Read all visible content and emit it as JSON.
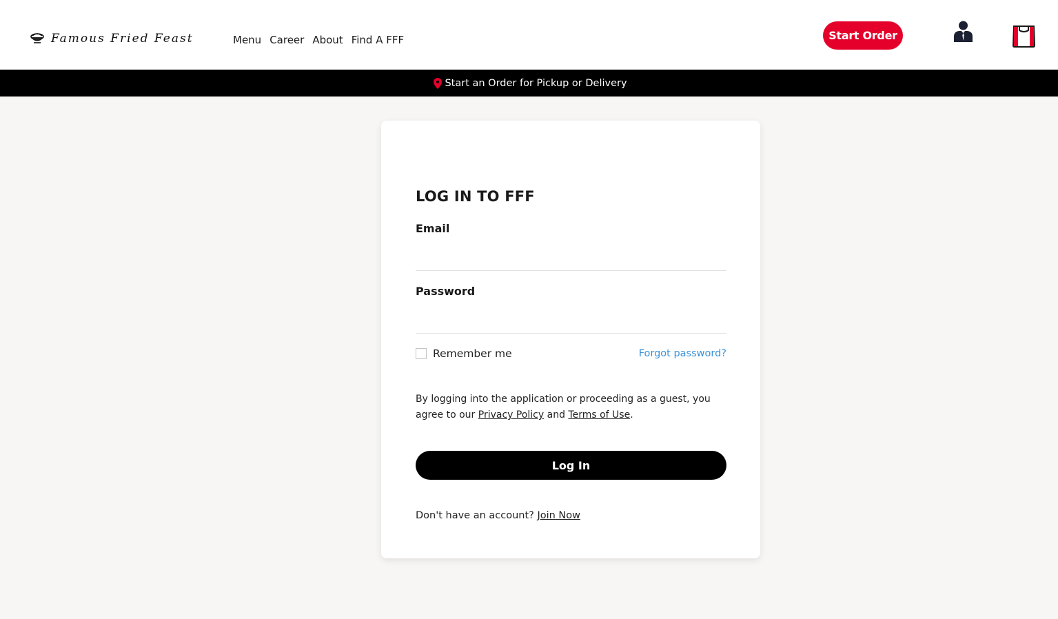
{
  "header": {
    "logo_text": "Famous Fried Feast",
    "logo_icon": "fried-chicken-bowl-icon",
    "nav": [
      "Menu",
      "Career",
      "About",
      "Find A FFF"
    ],
    "start_order_label": "Start Order",
    "account_icon": "user-account-icon",
    "cart_icon": "shopping-bag-icon",
    "brand_color": "#e4002b"
  },
  "promo": {
    "text": "Start an Order for Pickup or Delivery",
    "icon": "location-pin-icon"
  },
  "login": {
    "title": "LOG IN TO FFF",
    "email_label": "Email",
    "email_value": "",
    "password_label": "Password",
    "password_value": "",
    "remember_label": "Remember me",
    "forgot_label": "Forgot password?",
    "consent_prefix": "By logging into the application or proceeding as a guest, you agree to our",
    "privacy_label": "Privacy Policy",
    "consent_and": "and",
    "terms_label": "Terms of Use",
    "consent_suffix": ".",
    "login_button_label": "Log In",
    "signup_prompt": "Don't have an account?",
    "join_label": "Join Now",
    "link_color": "#3a92d8"
  }
}
